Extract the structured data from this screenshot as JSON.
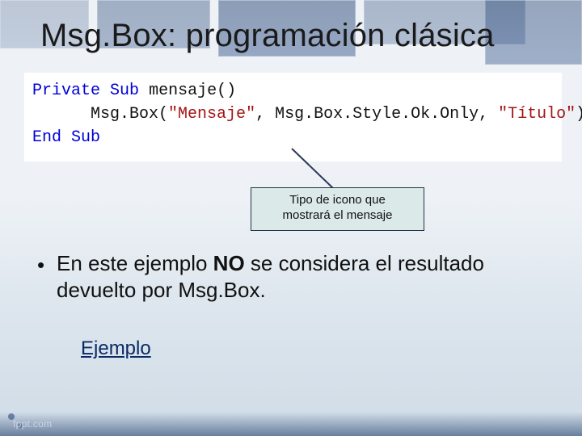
{
  "title": "Msg.Box: programación clásica",
  "code": {
    "line1": {
      "kw1": "Private",
      "kw2": "Sub",
      "name": "mensaje",
      "paren": "()"
    },
    "line2": {
      "indent": "      ",
      "fn": "Msg.Box",
      "open": "(",
      "arg1": "\"Mensaje\"",
      "sep1": ", ",
      "arg2": "Msg.Box.Style.Ok.Only",
      "sep2": ", ",
      "arg3": "\"Título\"",
      "close": ")"
    },
    "line3": {
      "kw1": "End",
      "kw2": "Sub"
    }
  },
  "callout": {
    "line1": "Tipo de icono que",
    "line2": "mostrará el mensaje"
  },
  "bullet": {
    "marker": "•",
    "pre": "En este ejemplo ",
    "bold": "NO",
    "post": " se considera el resultado devuelto por Msg.Box."
  },
  "link_text": "Ejemplo",
  "footer": "fppt.com"
}
